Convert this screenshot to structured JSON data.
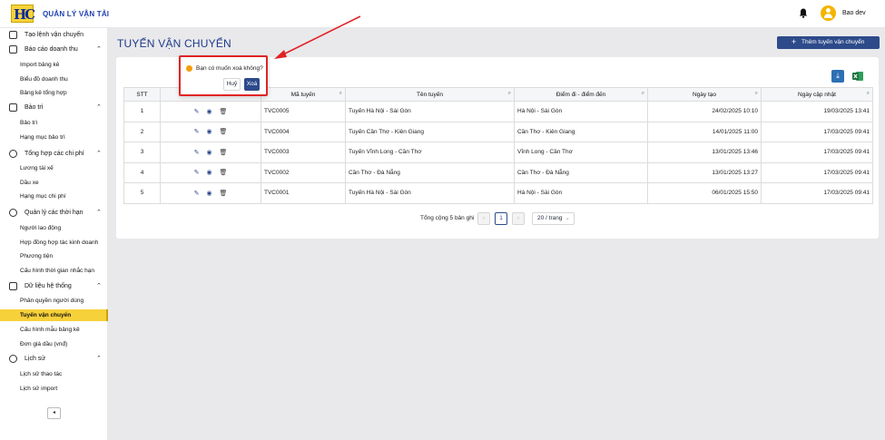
{
  "header": {
    "logo_text": "HC",
    "app_title": "QUẢN LÝ VẬN TẢI",
    "username": "Bao dev",
    "bell_icon": "bell-icon",
    "avatar_icon": "user-avatar-icon"
  },
  "sidebar": {
    "create_order": "Tạo lệnh vận chuyển",
    "revenue_report": "Báo cáo doanh thu",
    "import_sheet": "Import bảng kê",
    "revenue_chart": "Biểu đồ doanh thu",
    "summary_sheet": "Bảng kê tổng hợp",
    "maintenance_group": "Bảo trì",
    "maintenance": "Bảo trì",
    "maintenance_items": "Hạng mục bảo trì",
    "expense_group": "Tổng hợp các chi phí",
    "driver_salary": "Lương tài xế",
    "fuel": "Dầu xe",
    "expense_items": "Hạng mục chi phí",
    "deadline_group": "Quản lý các thời hạn",
    "workers": "Người lao động",
    "contracts": "Hợp đồng hợp tác kinh doanh",
    "vehicles": "Phương tiện",
    "reminder_config": "Cấu hình thời gian nhắc hạn",
    "system_group": "Dữ liệu hệ thống",
    "user_permissions": "Phân quyền người dùng",
    "routes": "Tuyến vận chuyển",
    "sheet_template": "Cấu hình mẫu bảng kê",
    "fuel_price": "Đơn giá dầu (vnđ)",
    "history_group": "Lịch sử",
    "action_history": "Lịch sử thao tác",
    "import_history": "Lịch sử import",
    "collapse": "◂"
  },
  "main": {
    "page_title": "TUYẾN VẬN CHUYỂN",
    "add_button": "Thêm tuyến vận chuyển",
    "columns": {
      "stt": "STT",
      "actions": "",
      "code": "Mã tuyến",
      "name": "Tên tuyến",
      "endpoints": "Điểm đi - điểm đến",
      "created": "Ngày tạo",
      "updated": "Ngày cập nhật"
    },
    "rows": [
      {
        "stt": "1",
        "code": "TVC0005",
        "name": "Tuyến Hà Nội - Sài Gòn",
        "endpoints": "Hà Nội - Sài Gòn",
        "created": "24/02/2025 10:10",
        "updated": "19/03/2025 13:41"
      },
      {
        "stt": "2",
        "code": "TVC0004",
        "name": "Tuyến Cần Thơ - Kiên Giang",
        "endpoints": "Cần Thơ - Kiên Giang",
        "created": "14/01/2025 11:00",
        "updated": "17/03/2025 09:41"
      },
      {
        "stt": "3",
        "code": "TVC0003",
        "name": "Tuyến Vĩnh Long - Cần Thơ",
        "endpoints": "Vĩnh Long - Cần Thơ",
        "created": "13/01/2025 13:46",
        "updated": "17/03/2025 09:41"
      },
      {
        "stt": "4",
        "code": "TVC0002",
        "name": "Cần Thơ - Đà Nẵng",
        "endpoints": "Cần Thơ - Đà Nẵng",
        "created": "13/01/2025 13:27",
        "updated": "17/03/2025 09:41"
      },
      {
        "stt": "5",
        "code": "TVC0001",
        "name": "Tuyến Hà Nội - Sài Gòn",
        "endpoints": "Hà Nội - Sài Gòn",
        "created": "06/01/2025 15:50",
        "updated": "17/03/2025 09:41"
      }
    ],
    "pagination": {
      "total": "Tổng cộng 5 bản ghi",
      "prev": "‹",
      "page": "1",
      "next": "›",
      "page_size": "20 / trang"
    }
  },
  "popconfirm": {
    "message": "Bạn có muốn xoá không?",
    "cancel": "Huỷ",
    "confirm": "Xoá"
  },
  "colors": {
    "primary": "#2d4a8a",
    "accent": "#f7d13a",
    "annotation": "#e02424"
  }
}
